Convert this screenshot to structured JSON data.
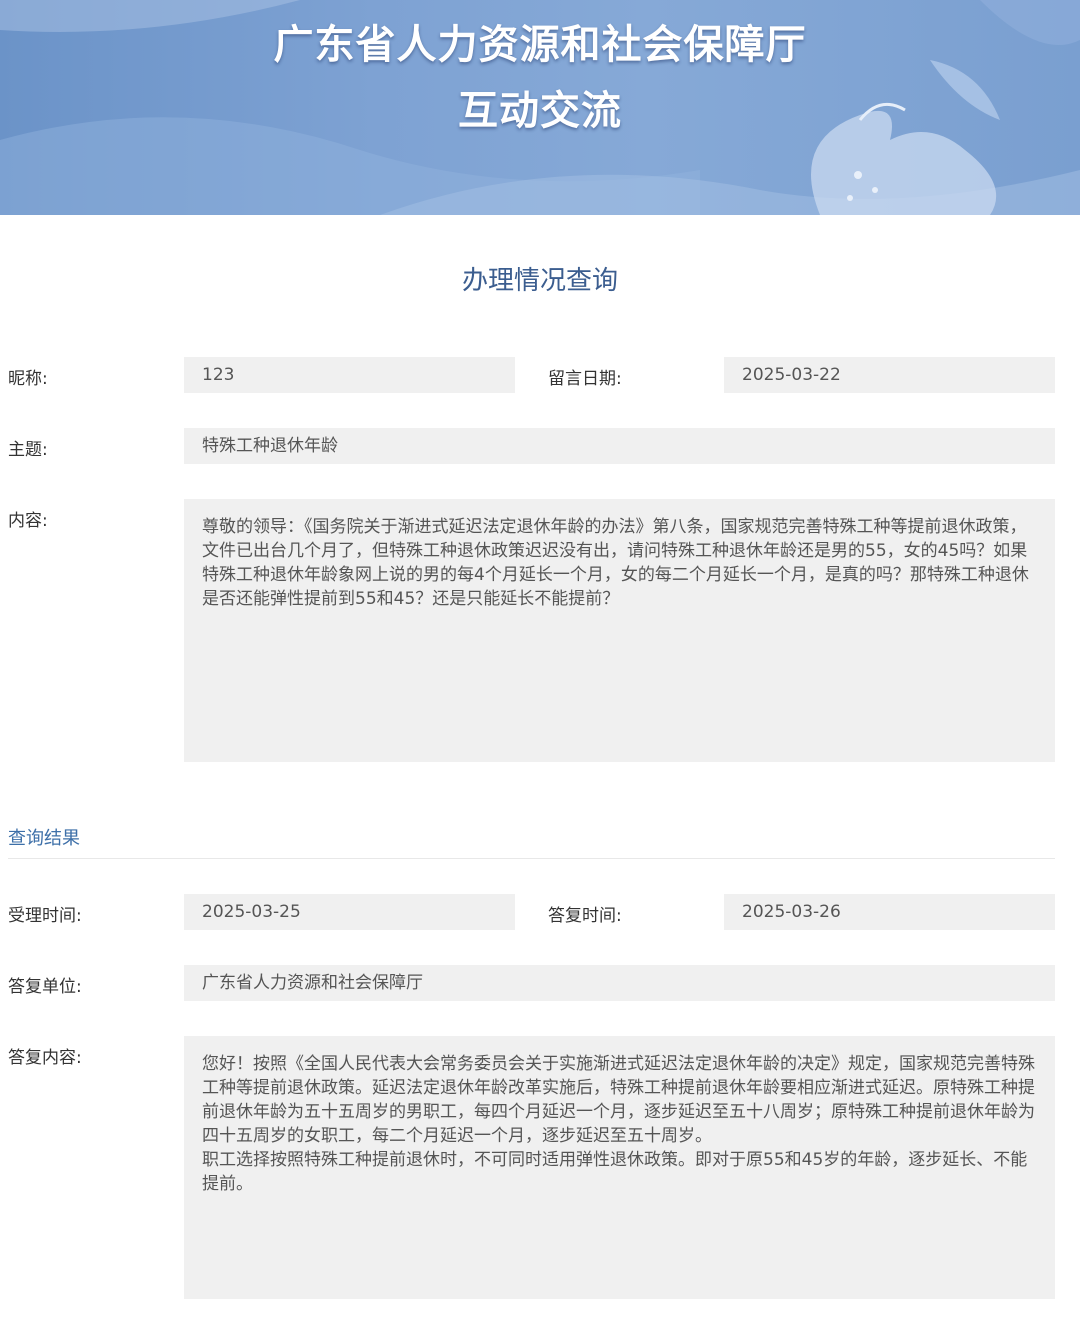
{
  "banner": {
    "title_line1": "广东省人力资源和社会保障厅",
    "title_line2": "互动交流"
  },
  "page_title": "办理情况查询",
  "message": {
    "nickname_label": "昵称:",
    "nickname_value": "123",
    "date_label": "留言日期:",
    "date_value": "2025-03-22",
    "subject_label": "主题:",
    "subject_value": "特殊工种退休年龄",
    "content_label": "内容:",
    "content_value": "尊敬的领导：《国务院关于渐进式延迟法定退休年龄的办法》第八条，国家规范完善特殊工种等提前退休政策，文件已出台几个月了，但特殊工种退休政策迟迟没有出，请问特殊工种退休年龄还是男的55，女的45吗？如果特殊工种退休年龄象网上说的男的每4个月延长一个月，女的每二个月延长一个月，是真的吗？那特殊工种退休是否还能弹性提前到55和45？还是只能延长不能提前？"
  },
  "result": {
    "section_label": "查询结果",
    "accept_time_label": "受理时间:",
    "accept_time_value": "2025-03-25",
    "reply_time_label": "答复时间:",
    "reply_time_value": "2025-03-26",
    "reply_unit_label": "答复单位:",
    "reply_unit_value": "广东省人力资源和社会保障厅",
    "reply_content_label": "答复内容:",
    "reply_content_value": "您好！按照《全国人民代表大会常务委员会关于实施渐进式延迟法定退休年龄的决定》规定，国家规范完善特殊工种等提前退休政策。延迟法定退休年龄改革实施后，特殊工种提前退休年龄要相应渐进式延迟。原特殊工种提前退休年龄为五十五周岁的男职工，每四个月延迟一个月，逐步延迟至五十八周岁；原特殊工种提前退休年龄为四十五周岁的女职工，每二个月延迟一个月，逐步延迟至五十周岁。\n职工选择按照特殊工种提前退休时，不可同时适用弹性退休政策。即对于原55和45岁的年龄，逐步延长、不能提前。"
  },
  "colors": {
    "banner_blue": "#7ea2d3",
    "title_blue": "#3b5d8f",
    "link_blue": "#3d6fa8",
    "field_gray": "#f0f0f0"
  }
}
